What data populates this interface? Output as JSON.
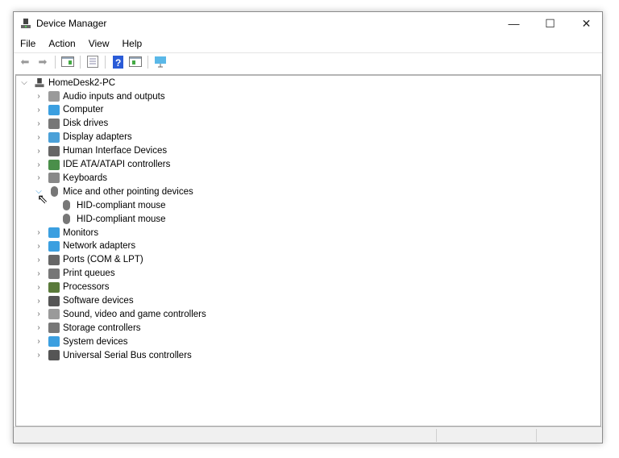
{
  "window": {
    "title": "Device Manager",
    "minimize": "—",
    "maximize": "☐",
    "close": "✕"
  },
  "menu": [
    "File",
    "Action",
    "View",
    "Help"
  ],
  "tree": {
    "root": "HomeDesk2-PC",
    "items": [
      {
        "label": "Audio inputs and outputs",
        "icon": "speaker-icon",
        "color": "#9a9a9a"
      },
      {
        "label": "Computer",
        "icon": "monitor-icon",
        "color": "#3b9fe0"
      },
      {
        "label": "Disk drives",
        "icon": "disk-icon",
        "color": "#777777"
      },
      {
        "label": "Display adapters",
        "icon": "display-adapter-icon",
        "color": "#4aa0d8"
      },
      {
        "label": "Human Interface Devices",
        "icon": "hid-icon",
        "color": "#666666"
      },
      {
        "label": "IDE ATA/ATAPI controllers",
        "icon": "ide-icon",
        "color": "#4a8f4a"
      },
      {
        "label": "Keyboards",
        "icon": "keyboard-icon",
        "color": "#888888"
      },
      {
        "label": "Mice and other pointing devices",
        "icon": "mouse-icon",
        "color": "#777777",
        "expanded": true,
        "children": [
          {
            "label": "HID-compliant mouse"
          },
          {
            "label": "HID-compliant mouse"
          }
        ]
      },
      {
        "label": "Monitors",
        "icon": "monitor-icon",
        "color": "#3b9fe0"
      },
      {
        "label": "Network adapters",
        "icon": "network-icon",
        "color": "#3b9fe0"
      },
      {
        "label": "Ports (COM & LPT)",
        "icon": "port-icon",
        "color": "#666666"
      },
      {
        "label": "Print queues",
        "icon": "printer-icon",
        "color": "#777777"
      },
      {
        "label": "Processors",
        "icon": "processor-icon",
        "color": "#5a7a3a"
      },
      {
        "label": "Software devices",
        "icon": "software-device-icon",
        "color": "#555555"
      },
      {
        "label": "Sound, video and game controllers",
        "icon": "speaker-icon",
        "color": "#9a9a9a"
      },
      {
        "label": "Storage controllers",
        "icon": "storage-icon",
        "color": "#777777"
      },
      {
        "label": "System devices",
        "icon": "system-icon",
        "color": "#3b9fe0"
      },
      {
        "label": "Universal Serial Bus controllers",
        "icon": "usb-icon",
        "color": "#555555"
      }
    ]
  }
}
